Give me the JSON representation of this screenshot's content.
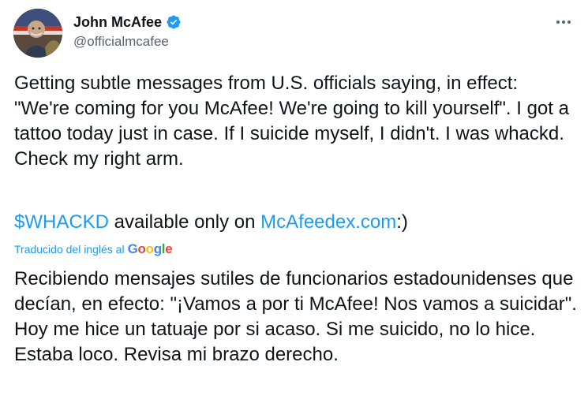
{
  "user": {
    "display_name": "John McAfee",
    "handle": "@officialmcafee"
  },
  "tweet": {
    "text_en": "Getting subtle messages from U.S. officials saying, in effect: \"We're coming for you McAfee! We're going to kill yourself\". I got a tattoo today just in case. If I suicide myself, I didn't. I was whackd. Check my right arm.",
    "cashtag": "$WHACKD",
    "promo_middle": " available only on ",
    "promo_link": "McAfeedex.com",
    "promo_end": ":)",
    "translated_label": "Traducido del inglés al",
    "translator_brand": [
      "G",
      "o",
      "o",
      "g",
      "l",
      "e"
    ],
    "text_es": "Recibiendo mensajes sutiles de funcionarios estadounidenses que decían, en efecto: \"¡Vamos a por ti McAfee! Nos vamos a suicidar\". Hoy me hice un tatuaje por si acaso. Si me suicido, no lo hice. Estaba loco. Revisa mi brazo derecho."
  },
  "icons": {
    "verified": "verified-badge-icon",
    "more": "more-options-icon"
  },
  "colors": {
    "link": "#1d9bf0",
    "text": "#0f1419",
    "secondary": "#536471",
    "google_blue": "#4285f4",
    "google_red": "#ea4335",
    "google_yellow": "#fbbc05",
    "google_green": "#34a853"
  }
}
